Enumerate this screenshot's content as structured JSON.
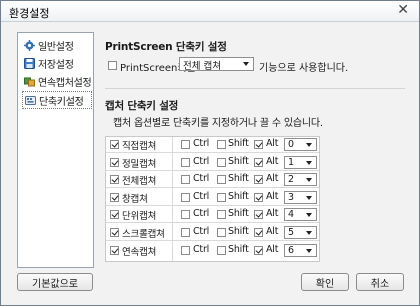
{
  "window": {
    "title": "환경설정"
  },
  "sidebar": {
    "items": [
      {
        "label": "일반설정",
        "icon": "gear-icon",
        "selected": false
      },
      {
        "label": "저장설정",
        "icon": "save-icon",
        "selected": false
      },
      {
        "label": "연속캡처설정",
        "icon": "sequence-capture-icon",
        "selected": false
      },
      {
        "label": "단축키설정",
        "icon": "shortcut-icon",
        "selected": true
      }
    ]
  },
  "printscreen": {
    "section_title": "PrintScreen 단축키 설정",
    "checkbox_label": "PrintScreen키를",
    "checked": false,
    "select_value": "전체 캡쳐",
    "suffix": "기능으로 사용합니다."
  },
  "capture_shortcuts": {
    "section_title": "캡처 단축키 설정",
    "description": "캡처 옵션별로 단축키를 지정하거나 끌 수 있습니다.",
    "modifier_labels": {
      "ctrl": "Ctrl",
      "shift": "Shift",
      "alt": "Alt"
    },
    "rows": [
      {
        "label": "직접캡쳐",
        "enabled": true,
        "ctrl": false,
        "shift": false,
        "alt": true,
        "key": "0"
      },
      {
        "label": "정밀캡쳐",
        "enabled": true,
        "ctrl": false,
        "shift": false,
        "alt": true,
        "key": "1"
      },
      {
        "label": "전체캡쳐",
        "enabled": true,
        "ctrl": false,
        "shift": false,
        "alt": true,
        "key": "2"
      },
      {
        "label": "창캡쳐",
        "enabled": true,
        "ctrl": false,
        "shift": false,
        "alt": true,
        "key": "3"
      },
      {
        "label": "단위캡쳐",
        "enabled": true,
        "ctrl": false,
        "shift": false,
        "alt": true,
        "key": "4"
      },
      {
        "label": "스크롤캡쳐",
        "enabled": true,
        "ctrl": false,
        "shift": false,
        "alt": true,
        "key": "5"
      },
      {
        "label": "연속캡쳐",
        "enabled": true,
        "ctrl": false,
        "shift": false,
        "alt": true,
        "key": "6"
      }
    ]
  },
  "buttons": {
    "defaults": "기본값으로",
    "ok": "확인",
    "cancel": "취소"
  }
}
